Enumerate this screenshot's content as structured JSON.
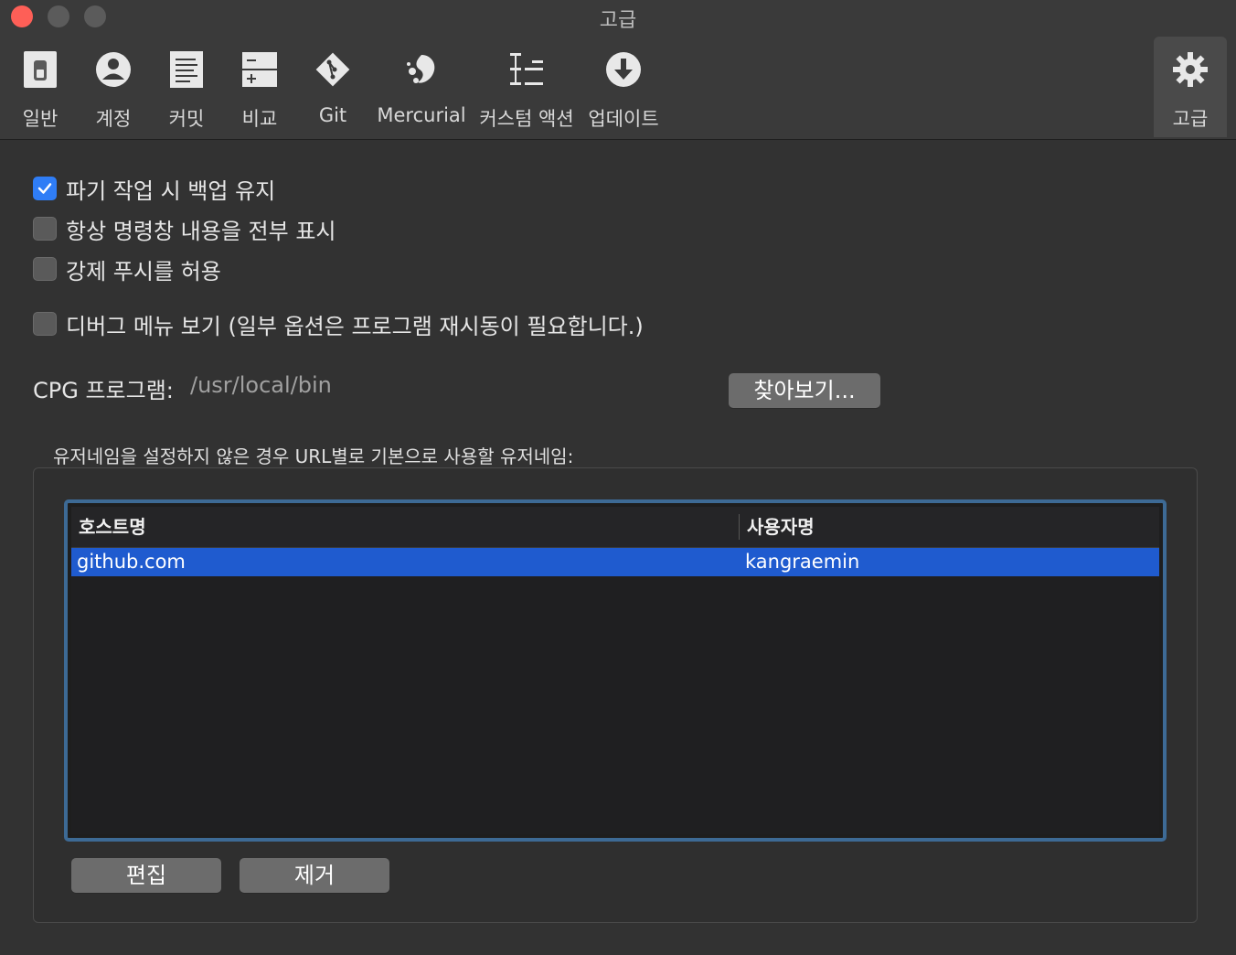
{
  "window": {
    "title": "고급"
  },
  "toolbar": {
    "items": [
      {
        "label": "일반",
        "icon": "switch-icon"
      },
      {
        "label": "계정",
        "icon": "person-icon"
      },
      {
        "label": "커밋",
        "icon": "document-icon"
      },
      {
        "label": "비교",
        "icon": "diff-icon"
      },
      {
        "label": "Git",
        "icon": "git-icon"
      },
      {
        "label": "Mercurial",
        "icon": "mercurial-icon"
      },
      {
        "label": "커스텀 액션",
        "icon": "custom-actions-icon"
      },
      {
        "label": "업데이트",
        "icon": "download-icon"
      },
      {
        "label": "고급",
        "icon": "gear-icon",
        "selected": true
      }
    ]
  },
  "options": {
    "keep_backup": {
      "label": "파기 작업 시 백업 유지",
      "checked": true
    },
    "show_full_output": {
      "label": "항상 명령창 내용을 전부 표시",
      "checked": false
    },
    "allow_force_push": {
      "label": "강제 푸시를 허용",
      "checked": false
    },
    "debug_menu": {
      "label": "디버그 메뉴 보기 (일부 옵션은 프로그램 재시동이 필요합니다.)",
      "checked": false
    }
  },
  "cpg": {
    "label": "CPG 프로그램:",
    "value": "/usr/local/bin",
    "browse_label": "찾아보기..."
  },
  "default_usernames": {
    "title": "유저네임을 설정하지 않은 경우 URL별로 기본으로 사용할 유저네임:",
    "columns": [
      "호스트명",
      "사용자명"
    ],
    "rows": [
      {
        "host": "github.com",
        "user": "kangraemin",
        "selected": true
      }
    ],
    "edit_label": "편집",
    "remove_label": "제거"
  },
  "colors": {
    "accent": "#2f7df6",
    "selection": "#1f5bcf",
    "close": "#fe5f57"
  }
}
